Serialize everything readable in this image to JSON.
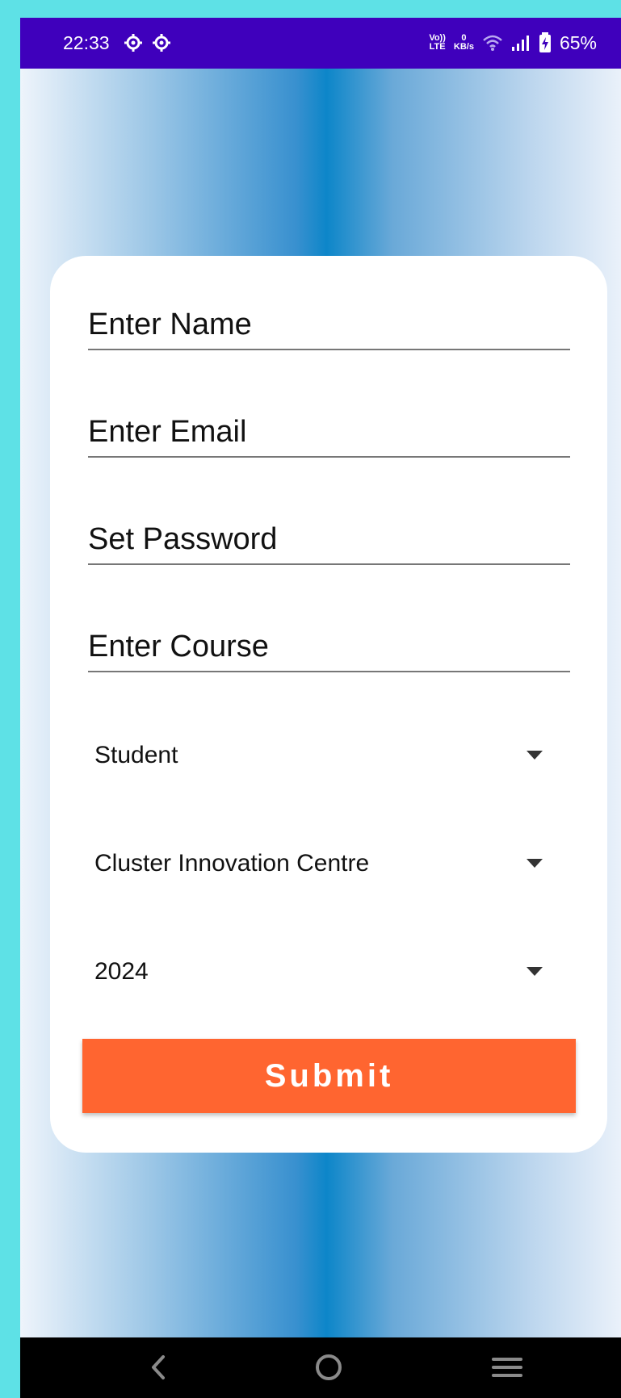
{
  "status_bar": {
    "time": "22:33",
    "network_label_top": "Vo))",
    "network_label_bottom": "LTE",
    "speed_value": "0",
    "speed_unit": "KB/s",
    "battery": "65%"
  },
  "form": {
    "name_placeholder": "Enter Name",
    "email_placeholder": "Enter Email",
    "password_placeholder": "Set Password",
    "course_placeholder": "Enter Course",
    "role_selected": "Student",
    "college_selected": "Cluster Innovation Centre",
    "year_selected": "2024",
    "submit_label": "Submit"
  },
  "colors": {
    "status_bar": "#3f00bc",
    "submit_button": "#ff6530",
    "outer_background": "#5ee1e6",
    "gradient_center": "#0d86c9"
  },
  "icons": {
    "status_left": [
      "gear-icon",
      "gear-icon"
    ],
    "status_right": [
      "wifi-icon",
      "signal-icon",
      "battery-charging-icon"
    ],
    "navigation": [
      "back-icon",
      "home-icon",
      "menu-icon"
    ]
  }
}
